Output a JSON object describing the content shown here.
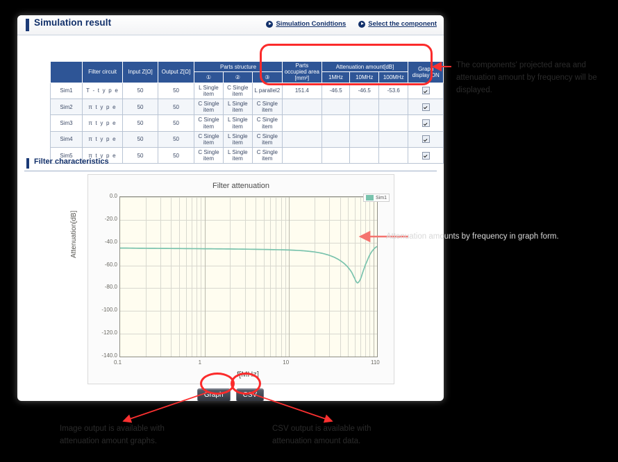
{
  "panel": {
    "section_title": "Simulation result",
    "links": [
      {
        "label": "Simulation Conidtions",
        "icon": "play-circle-icon"
      },
      {
        "label": "Select the component",
        "icon": "play-circle-icon"
      }
    ],
    "filter_section_title": "Filter characteristics"
  },
  "table": {
    "headers": {
      "blank": "",
      "filter_circuit": "Filter circuit",
      "input_z": "Input Z[Ω]",
      "output_z": "Output Z[Ω]",
      "parts_structure": "Parts structure",
      "parts_1": "①",
      "parts_2": "②",
      "parts_3": "③",
      "parts_occupied_area": "Parts occupied area [mm²]",
      "attenuation_amount": "Attenuation amount[dB]",
      "f_1mhz": "1MHz",
      "f_10mhz": "10MHz",
      "f_100mhz": "100MHz",
      "graph_display_on": "Graph display ON"
    },
    "rows": [
      {
        "name": "Sim1",
        "circuit": "T - t y p e",
        "input_z": "50",
        "output_z": "50",
        "p1": "L Single item",
        "p2": "C Single item",
        "p3": "L parallel2",
        "area": "151.4",
        "a1": "-46.5",
        "a10": "-46.5",
        "a100": "-53.6",
        "checked": true
      },
      {
        "name": "Sim2",
        "circuit": "π   t y p e",
        "input_z": "50",
        "output_z": "50",
        "p1": "C Single item",
        "p2": "L Single item",
        "p3": "C Single item",
        "area": "",
        "a1": "",
        "a10": "",
        "a100": "",
        "checked": true
      },
      {
        "name": "Sim3",
        "circuit": "π   t y p e",
        "input_z": "50",
        "output_z": "50",
        "p1": "C Single item",
        "p2": "L Single item",
        "p3": "C Single item",
        "area": "",
        "a1": "",
        "a10": "",
        "a100": "",
        "checked": true
      },
      {
        "name": "Sim4",
        "circuit": "π   t y p e",
        "input_z": "50",
        "output_z": "50",
        "p1": "C Single item",
        "p2": "L Single item",
        "p3": "C Single item",
        "area": "",
        "a1": "",
        "a10": "",
        "a100": "",
        "checked": true
      },
      {
        "name": "Sim5",
        "circuit": "π   t y p e",
        "input_z": "50",
        "output_z": "50",
        "p1": "C Single item",
        "p2": "L Single item",
        "p3": "C Single item",
        "area": "",
        "a1": "",
        "a10": "",
        "a100": "",
        "checked": true
      }
    ]
  },
  "buttons": {
    "graph": "Graph",
    "csv": "CSV"
  },
  "annotations": {
    "table_note": "The components' projected area and attenuation amount by frequency will be displayed.",
    "chart_note": "Attenuation amounts by frequency in graph form.",
    "graph_btn_note": "Image output is available with attenuation amount graphs.",
    "csv_btn_note": "CSV output is available with attenuation amount data.",
    "accent_color": "#fb2b2b"
  },
  "chart_data": {
    "type": "line",
    "title": "Filter attenuation",
    "xlabel": "f[MHz]",
    "ylabel": "Attenuation[dB]",
    "xscale": "log",
    "xlim": [
      0.1,
      110
    ],
    "ylim": [
      -140.0,
      0.0
    ],
    "xticks": [
      "0.1",
      "1",
      "10",
      "110"
    ],
    "yticks": [
      "0.0",
      "-20.0",
      "-40.0",
      "-60.0",
      "-80.0",
      "-100.0",
      "-120.0",
      "-140.0"
    ],
    "grid": true,
    "legend": {
      "position": "top-right",
      "entries": [
        {
          "name": "Sim1",
          "color": "#79c3ad"
        }
      ]
    },
    "series": [
      {
        "name": "Sim1",
        "color": "#79c3ad",
        "x": [
          0.1,
          0.2,
          0.5,
          1,
          2,
          5,
          10,
          15,
          20,
          25,
          30,
          35,
          40,
          45,
          50,
          55,
          60,
          62,
          65,
          70,
          75,
          80,
          90,
          100,
          110
        ],
        "y": [
          -44.8,
          -45.0,
          -45.2,
          -45.4,
          -45.6,
          -46.0,
          -46.5,
          -47.2,
          -48.2,
          -49.5,
          -51.2,
          -53.2,
          -55.6,
          -58.4,
          -61.8,
          -66.0,
          -71.5,
          -74.0,
          -75.3,
          -72.0,
          -65.5,
          -59.5,
          -51.0,
          -46.0,
          -43.5
        ]
      }
    ]
  }
}
